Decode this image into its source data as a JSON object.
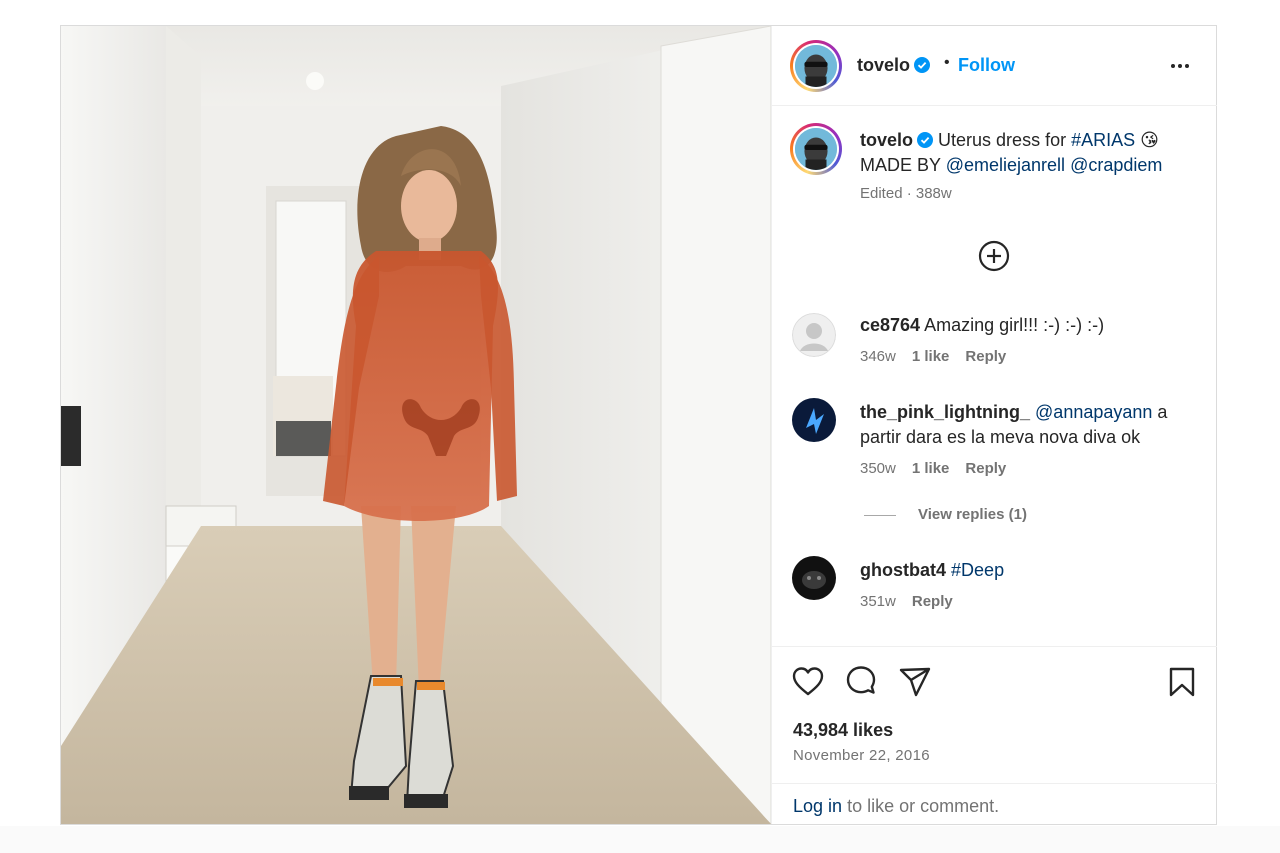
{
  "post": {
    "author": "tovelo",
    "dot": "•",
    "follow_label": "Follow",
    "more_icon": "more-horizontal-icon",
    "caption": {
      "username": "tovelo",
      "text_1": "Uterus dress for",
      "hashtag": "#ARIAS",
      "emoji": "😘",
      "text_2": "MADE BY",
      "mention_1": "@emeliejanrell",
      "mention_2": "@crapdiem",
      "meta": "Edited · 388w"
    },
    "load_more_icon": "plus-circle-icon"
  },
  "comments": [
    {
      "username": "ce8764",
      "text": "Amazing girl!!! :-) :-) :-)",
      "age": "346w",
      "likes": "1 like",
      "reply": "Reply"
    },
    {
      "username": "the_pink_lightning_",
      "mention": "@annapayann",
      "text": "a partir dara es la meva nova diva ok",
      "age": "350w",
      "likes": "1 like",
      "reply": "Reply",
      "view_replies": "View replies (1)"
    },
    {
      "username": "ghostbat4",
      "hashtag": "#Deep",
      "age": "351w",
      "reply": "Reply"
    }
  ],
  "actions": {
    "icons": [
      "heart-icon",
      "comment-icon",
      "share-icon",
      "bookmark-icon"
    ],
    "likes": "43,984 likes",
    "date": "November 22, 2016",
    "login_link": "Log in",
    "login_rest": "to like or comment."
  },
  "colors": {
    "follow": "#0095f6",
    "link": "#00376b",
    "muted": "#737373",
    "text": "#262626",
    "border": "#dbdbdb"
  }
}
